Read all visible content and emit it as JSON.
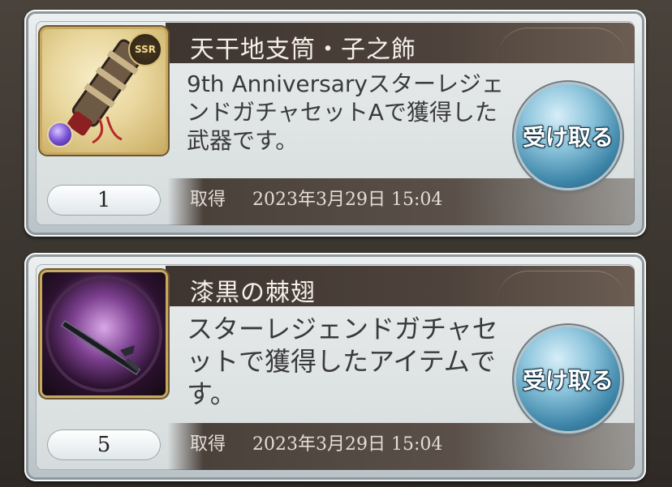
{
  "items": [
    {
      "name": "天干地支筒・子之飾",
      "description": "9th AnniversaryスターレジェンドガチャセットAで獲得した武器です。",
      "rarity_badge": "SSR",
      "quantity": "1",
      "acquired_label": "取得",
      "acquired_date": "2023年3月29日 15:04",
      "button_label": "受け取る",
      "icon": "cannon-weapon-icon"
    },
    {
      "name": "漆黒の棘翅",
      "description": "スターレジェンドガチャセットで獲得したアイテムです。",
      "quantity": "5",
      "acquired_label": "取得",
      "acquired_date": "2023年3月29日 15:04",
      "button_label": "受け取る",
      "icon": "dark-sword-icon"
    }
  ],
  "colors": {
    "title_bar": "#4e433c",
    "button_blue": "#3d85a8",
    "panel": "#d6dcdd"
  }
}
